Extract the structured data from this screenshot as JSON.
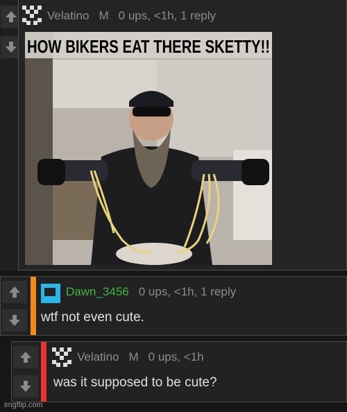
{
  "comment1": {
    "username": "Velatino",
    "badge": "M",
    "stats": "0 ups, <1h, 1 reply",
    "image_caption": "HOW BIKERS EAT THERE SKETTY!!"
  },
  "comment2": {
    "username": "Dawn_3456",
    "stats": "0 ups, <1h, 1 reply",
    "text": "wtf not even cute.",
    "accent_color": "#f08a1a",
    "username_color": "#3fb43f"
  },
  "comment3": {
    "username": "Velatino",
    "badge": "M",
    "stats": "0 ups, <1h",
    "text": "was it supposed to be cute?",
    "accent_color": "#e8322d"
  },
  "watermark": "imgflip.com",
  "icons": {
    "upvote": "arrow-up-icon",
    "downvote": "arrow-down-icon",
    "avatar_velatino": "pixel-avatar-icon",
    "avatar_dawn": "blue-square-avatar-icon"
  }
}
